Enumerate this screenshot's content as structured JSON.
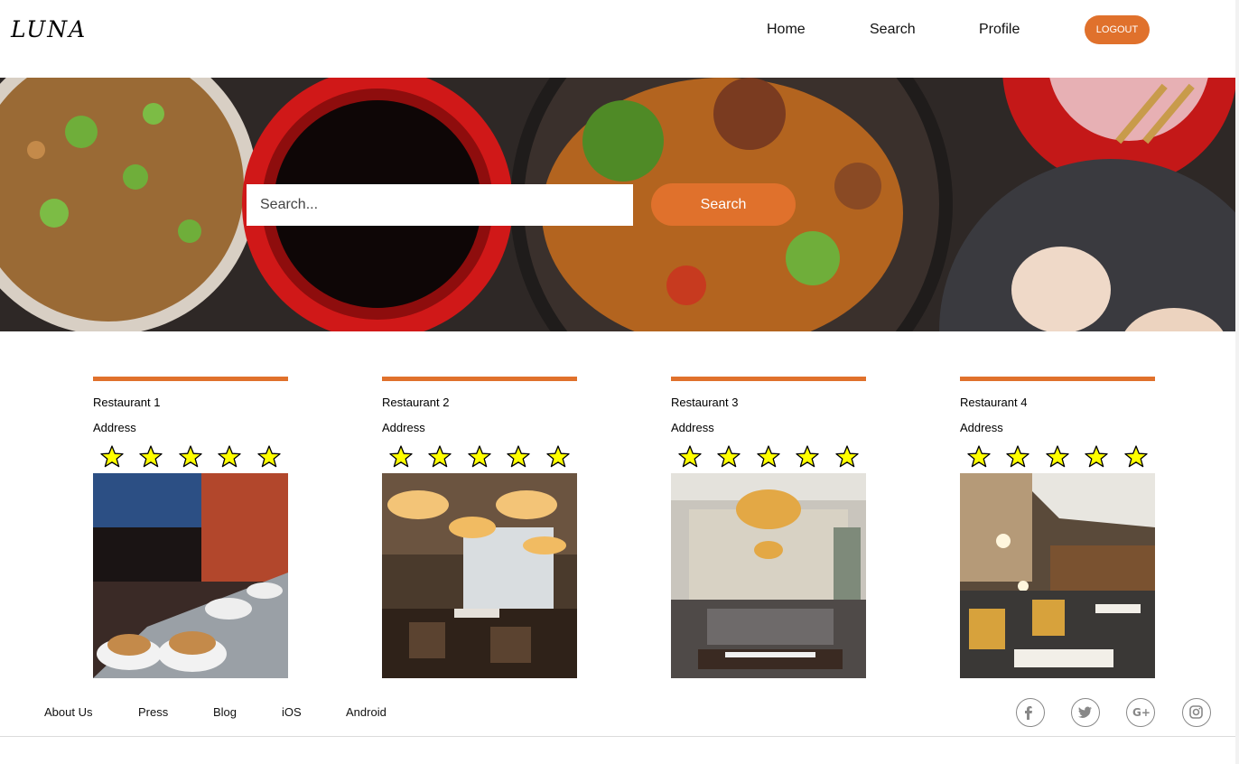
{
  "header": {
    "logo": "LUNA",
    "nav": {
      "home": "Home",
      "search": "Search",
      "profile": "Profile"
    },
    "logout_label": "LOGOUT"
  },
  "hero": {
    "search_placeholder": "Search...",
    "search_button": "Search"
  },
  "restaurants": [
    {
      "name": "Restaurant 1",
      "address": "Address",
      "rating": 5
    },
    {
      "name": "Restaurant 2",
      "address": "Address",
      "rating": 5
    },
    {
      "name": "Restaurant 3",
      "address": "Address",
      "rating": 5
    },
    {
      "name": "Restaurant 4",
      "address": "Address",
      "rating": 5
    }
  ],
  "footer": {
    "links": [
      "About Us",
      "Press",
      "Blog",
      "iOS",
      "Android"
    ],
    "social": [
      "facebook-icon",
      "twitter-icon",
      "google-plus-icon",
      "instagram-icon"
    ]
  },
  "colors": {
    "accent": "#e0712c",
    "star": "#ffff00"
  }
}
